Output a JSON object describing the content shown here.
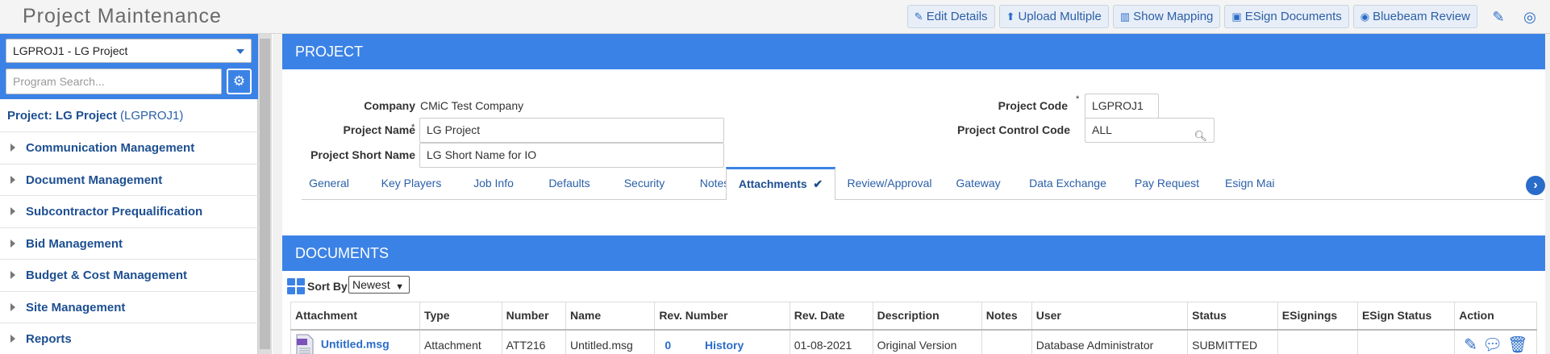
{
  "app": {
    "title": "Project Maintenance"
  },
  "toolbar": {
    "edit_details": "Edit Details",
    "upload_multiple": "Upload Multiple",
    "show_mapping": "Show Mapping",
    "esign_documents": "ESign Documents",
    "bluebeam_review": "Bluebeam Review"
  },
  "sidebar": {
    "project_select_value": "LGPROJ1 - LG Project",
    "search_placeholder": "Program Search...",
    "project_label": "Project: LG Project",
    "project_code": "(LGPROJ1)",
    "items": [
      {
        "label": "Communication Management"
      },
      {
        "label": "Document Management"
      },
      {
        "label": "Subcontractor Prequalification"
      },
      {
        "label": "Bid Management"
      },
      {
        "label": "Budget & Cost Management"
      },
      {
        "label": "Site Management"
      },
      {
        "label": "Reports"
      }
    ]
  },
  "project": {
    "section_title": "PROJECT",
    "company_label": "Company",
    "company_value": "CMiC Test Company",
    "name_label": "Project Name",
    "name_value": "LG Project",
    "short_name_label": "Project Short Name",
    "short_name_value": "LG Short Name for IO",
    "code_label": "Project Code",
    "code_value": "LGPROJ1",
    "control_code_label": "Project Control Code",
    "control_code_value": "ALL",
    "required_mark": "*"
  },
  "tabs": [
    {
      "label": "General"
    },
    {
      "label": "Key Players"
    },
    {
      "label": "Job Info"
    },
    {
      "label": "Defaults"
    },
    {
      "label": "Security"
    },
    {
      "label": "Notes"
    },
    {
      "label": "Attachments"
    },
    {
      "label": "Review/Approval"
    },
    {
      "label": "Gateway"
    },
    {
      "label": "Data Exchange"
    },
    {
      "label": "Pay Request"
    },
    {
      "label": "Esign Mai"
    }
  ],
  "documents": {
    "section_title": "DOCUMENTS",
    "sort_label": "Sort By:",
    "sort_value": "Newest",
    "columns": [
      "Attachment",
      "Type",
      "Number",
      "Name",
      "Rev. Number",
      "Rev. Date",
      "Description",
      "Notes",
      "User",
      "Status",
      "ESignings",
      "ESign Status",
      "Action"
    ],
    "rows": [
      {
        "attachment": "Untitled.msg",
        "type": "Attachment",
        "number": "ATT216",
        "name": "Untitled.msg",
        "rev_number": "0",
        "history": "History",
        "rev_date": "01-08-2021",
        "description": "Original Version",
        "notes": "",
        "user": "Database Administrator",
        "status": "SUBMITTED",
        "esignings": "",
        "esign_status": ""
      }
    ]
  },
  "colors": {
    "accent": "#3b82e6",
    "link": "#2a6cc9",
    "nav_text": "#1d4f91"
  }
}
